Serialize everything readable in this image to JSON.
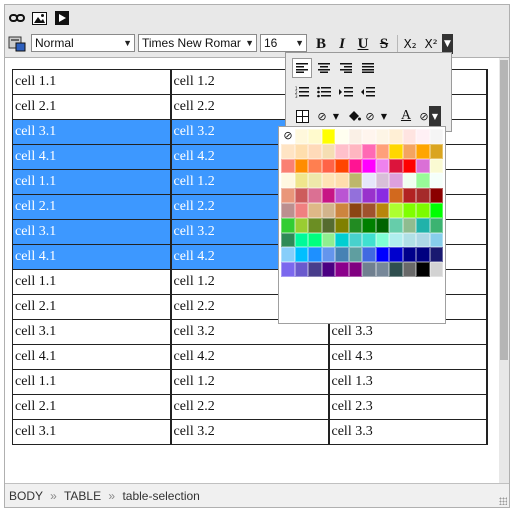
{
  "toolbar1": {
    "buttons": [
      {
        "name": "link-icon",
        "glyph": "⚭"
      },
      {
        "name": "image-icon",
        "glyph": "▣"
      },
      {
        "name": "media-icon",
        "glyph": "▶"
      }
    ]
  },
  "toolbar2": {
    "format_select": "Normal",
    "font_select": "Times New Romar",
    "size_select": "16",
    "bold": "B",
    "italic": "I",
    "underline": "U",
    "strike": "S",
    "subscript": "X₂",
    "superscript": "X²"
  },
  "popup": {
    "row1": [
      "≡",
      "≡",
      "≡",
      "≡"
    ],
    "row2": [
      "☰",
      "☰",
      "⇥",
      "⇤"
    ],
    "row3_table": "⊞",
    "row3_bg_color": "⊘",
    "row3_paint": "◈",
    "row3_no_color": "⊘",
    "row3_text_color": "A",
    "row3_clear": "⊘"
  },
  "table": {
    "rows": [
      {
        "c1": "cell 1.1",
        "c2": "cell 1.2",
        "c3": "",
        "state": "normal"
      },
      {
        "c1": "cell 2.1",
        "c2": "cell 2.2",
        "c3": "",
        "state": "normal"
      },
      {
        "c1": "cell 3.1",
        "c2": "cell 3.2",
        "c3": "",
        "state": "selected"
      },
      {
        "c1": "cell 4.1",
        "c2": "cell 4.2",
        "c3": "",
        "state": "selected"
      },
      {
        "c1": "cell 1.1",
        "c2": "cell 1.2",
        "c3": "",
        "state": "selected"
      },
      {
        "c1": "cell 2.1",
        "c2": "cell 2.2",
        "c3": "",
        "state": "selected"
      },
      {
        "c1": "cell 3.1",
        "c2": "cell 3.2",
        "c3": "",
        "state": "selected"
      },
      {
        "c1": "cell 4.1",
        "c2": "cell 4.2",
        "c3": "",
        "state": "selected"
      },
      {
        "c1": "cell 1.1",
        "c2": "cell 1.2",
        "c3": "",
        "state": "normal"
      },
      {
        "c1": "cell 2.1",
        "c2": "cell 2.2",
        "c3": "cell 2.3",
        "state": "normal"
      },
      {
        "c1": "cell 3.1",
        "c2": "cell 3.2",
        "c3": "cell 3.3",
        "state": "normal"
      },
      {
        "c1": "cell 4.1",
        "c2": "cell 4.2",
        "c3": "cell 4.3",
        "state": "normal"
      },
      {
        "c1": "cell 1.1",
        "c2": "cell 1.2",
        "c3": "cell 1.3",
        "state": "normal"
      },
      {
        "c1": "cell 2.1",
        "c2": "cell 2.2",
        "c3": "cell 2.3",
        "state": "normal"
      },
      {
        "c1": "cell 3.1",
        "c2": "cell 3.2",
        "c3": "cell 3.3",
        "state": "normal"
      }
    ]
  },
  "palette": [
    "#ffffff",
    "#fff8dc",
    "#fffacd",
    "#ffff00",
    "#fffff0",
    "#faf0e6",
    "#fff5ee",
    "#fdf5e6",
    "#ffefd5",
    "#ffe4e1",
    "#fff0f5",
    "#f5f5f5",
    "#ffe4c4",
    "#ffdead",
    "#ffdab9",
    "#f5deb3",
    "#ffc0cb",
    "#ffb6c1",
    "#ff69b4",
    "#ffa07a",
    "#ffd700",
    "#f4a460",
    "#ffa500",
    "#daa520",
    "#fa8072",
    "#ff8c00",
    "#ff7f50",
    "#ff6347",
    "#ff4500",
    "#ff1493",
    "#ff00ff",
    "#ee82ee",
    "#dc143c",
    "#ff0000",
    "#da70d6",
    "#fafad2",
    "#fff8e1",
    "#f0e68c",
    "#eee8aa",
    "#ffe4b5",
    "#ffdead",
    "#bdb76b",
    "#e6e6fa",
    "#d8bfd8",
    "#dda0dd",
    "#f0fff0",
    "#98fb98",
    "#f5fffa",
    "#e9967a",
    "#cd5c5c",
    "#db7093",
    "#c71585",
    "#ba55d3",
    "#9370db",
    "#9932cc",
    "#8a2be2",
    "#d2691e",
    "#b22222",
    "#a52a2a",
    "#8b0000",
    "#bc8f8f",
    "#f08080",
    "#deb887",
    "#d2b48c",
    "#cd853f",
    "#8b4513",
    "#a0522d",
    "#b8860b",
    "#adff2f",
    "#7fff00",
    "#7cfc00",
    "#00ff00",
    "#32cd32",
    "#9acd32",
    "#6b8e23",
    "#556b2f",
    "#808000",
    "#228b22",
    "#008000",
    "#006400",
    "#66cdaa",
    "#8fbc8f",
    "#20b2aa",
    "#3cb371",
    "#2e8b57",
    "#00fa9a",
    "#00ff7f",
    "#90ee90",
    "#00ced1",
    "#48d1cc",
    "#40e0d0",
    "#7fffd4",
    "#afeeee",
    "#b0e0e6",
    "#add8e6",
    "#87ceeb",
    "#87cefa",
    "#00bfff",
    "#1e90ff",
    "#6495ed",
    "#4682b4",
    "#5f9ea0",
    "#4169e1",
    "#0000ff",
    "#0000cd",
    "#00008b",
    "#000080",
    "#191970",
    "#7b68ee",
    "#6a5acd",
    "#483d8b",
    "#4b0082",
    "#8b008b",
    "#800080",
    "#708090",
    "#778899",
    "#2f4f4f",
    "#696969",
    "#000000",
    "#d3d3d3"
  ],
  "statusbar": {
    "path": [
      "BODY",
      "TABLE",
      "table-selection"
    ],
    "sep": "»"
  }
}
